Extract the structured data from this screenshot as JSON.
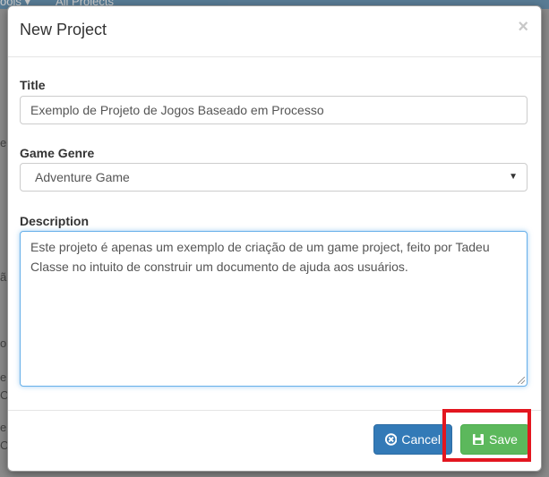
{
  "background": {
    "topbar_fragments": [
      "ools ▾",
      "All Projects"
    ],
    "side_fragments": [
      "e",
      "ã",
      "o",
      "e",
      "C",
      "e",
      "C"
    ]
  },
  "modal": {
    "title": "New Project",
    "close_glyph": "×",
    "title_field": {
      "label": "Title",
      "value": "Exemplo de Projeto de Jogos Baseado em Processo"
    },
    "genre_field": {
      "label": "Game Genre",
      "selected": "Adventure Game"
    },
    "description_field": {
      "label": "Description",
      "value": "Este projeto é apenas um exemplo de criação de um game project, feito por Tadeu Classe no intuito de construir um documento de ajuda aos usuários."
    },
    "footer": {
      "cancel_label": "Cancel",
      "save_label": "Save"
    }
  },
  "colors": {
    "primary": "#337ab7",
    "success": "#5cb85c",
    "highlight": "#e3161f",
    "focus": "#66afe9"
  },
  "icons": {
    "cancel": "times-circle-icon",
    "save": "save-icon",
    "select_caret": "caret-down-icon"
  }
}
